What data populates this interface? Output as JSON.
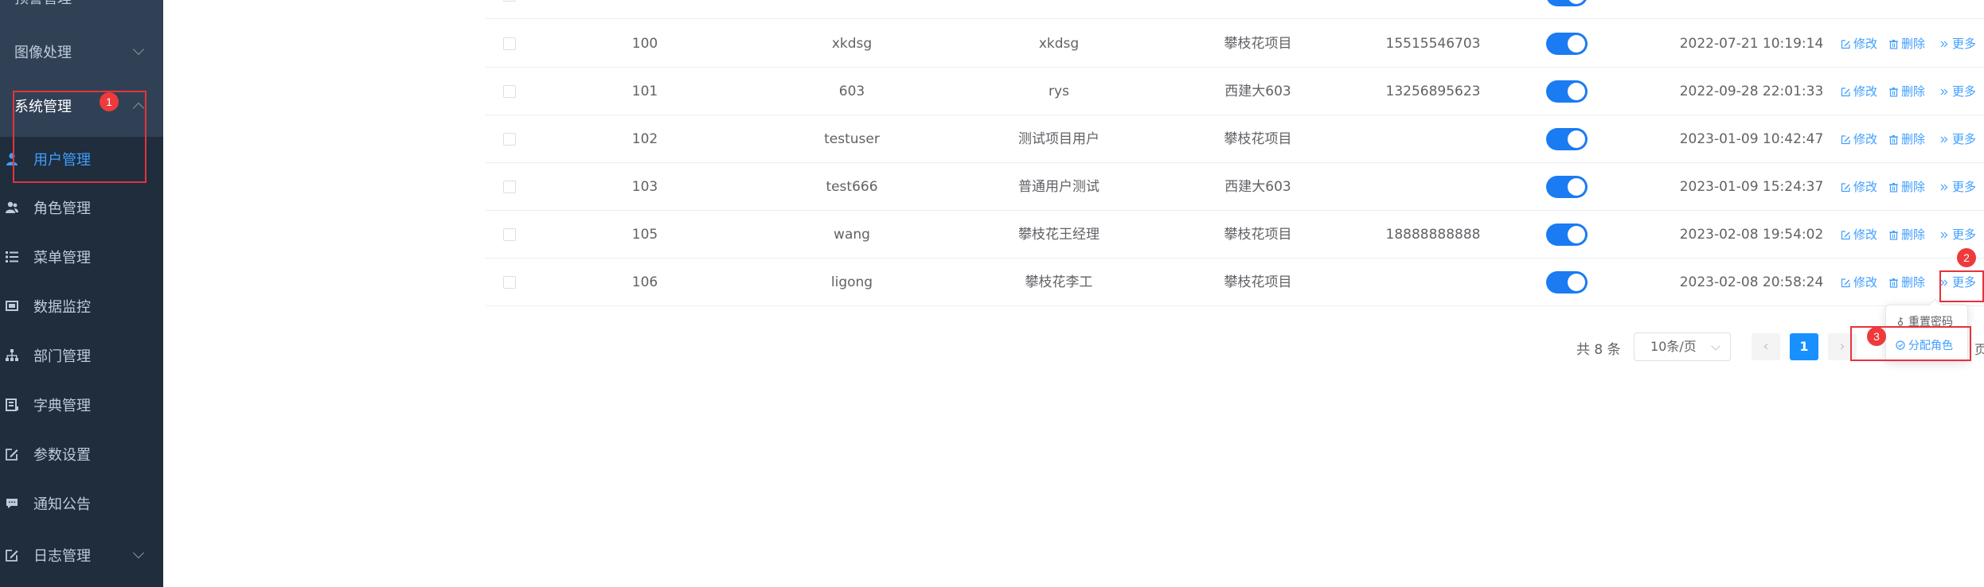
{
  "sidebar": {
    "top_cut_label": "预警管理",
    "image_processing": "图像处理",
    "system_admin": "系统管理",
    "items": [
      {
        "label": "用户管理",
        "icon": "user-icon"
      },
      {
        "label": "角色管理",
        "icon": "users-icon"
      },
      {
        "label": "菜单管理",
        "icon": "tree-list-icon"
      },
      {
        "label": "数据监控",
        "icon": "monitor-icon"
      },
      {
        "label": "部门管理",
        "icon": "org-tree-icon"
      },
      {
        "label": "字典管理",
        "icon": "dict-icon"
      },
      {
        "label": "参数设置",
        "icon": "edit-icon"
      },
      {
        "label": "通知公告",
        "icon": "message-icon"
      },
      {
        "label": "日志管理",
        "icon": "log-icon"
      }
    ]
  },
  "annotations": {
    "badge1": "1",
    "badge2": "2",
    "badge3": "3"
  },
  "table": {
    "rows": [
      {
        "id": "100",
        "username": "xkdsg",
        "nickname": "xkdsg",
        "dept": "攀枝花项目",
        "phone": "15515546703",
        "status": true,
        "created": "2022-07-21 10:19:14"
      },
      {
        "id": "101",
        "username": "603",
        "nickname": "rys",
        "dept": "西建大603",
        "phone": "13256895623",
        "status": true,
        "created": "2022-09-28 22:01:33"
      },
      {
        "id": "102",
        "username": "testuser",
        "nickname": "测试项目用户",
        "dept": "攀枝花项目",
        "phone": "",
        "status": true,
        "created": "2023-01-09 10:42:47"
      },
      {
        "id": "103",
        "username": "test666",
        "nickname": "普通用户测试",
        "dept": "西建大603",
        "phone": "",
        "status": true,
        "created": "2023-01-09 15:24:37"
      },
      {
        "id": "105",
        "username": "wang",
        "nickname": "攀枝花王经理",
        "dept": "攀枝花项目",
        "phone": "18888888888",
        "status": true,
        "created": "2023-02-08 19:54:02"
      },
      {
        "id": "106",
        "username": "ligong",
        "nickname": "攀枝花李工",
        "dept": "攀枝花项目",
        "phone": "",
        "status": true,
        "created": "2023-02-08 20:58:24"
      }
    ],
    "actions": {
      "edit": "修改",
      "delete": "删除",
      "more": "更多"
    }
  },
  "pagination": {
    "total": "共 8 条",
    "page_size": "10条/页",
    "current_page": "1",
    "prev": "‹",
    "next": "›",
    "tail": "页"
  },
  "dropdown": {
    "reset_password": "重置密码",
    "assign_role": "分配角色"
  },
  "colors": {
    "sidebar_bg": "#304156",
    "submenu_bg": "#1f2d3d",
    "accent": "#409eff",
    "annotation": "#e6333b"
  }
}
